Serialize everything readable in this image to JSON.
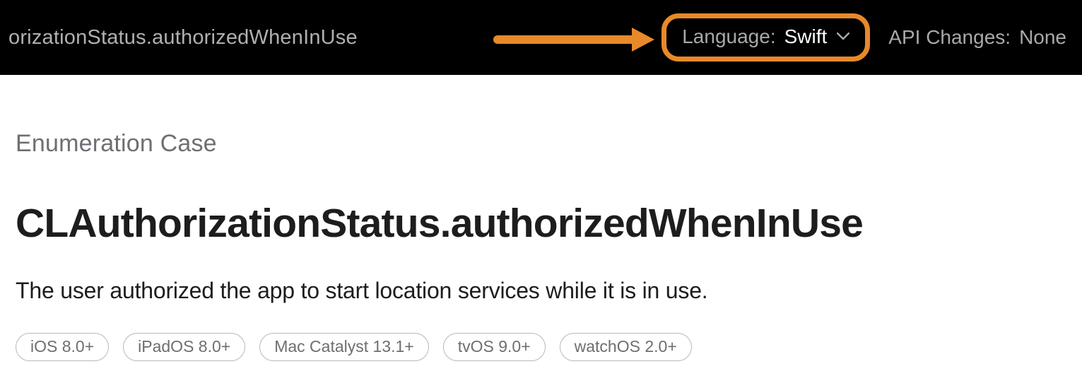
{
  "header": {
    "breadcrumb_fragment": "orizationStatus.authorizedWhenInUse",
    "language_label": "Language:",
    "language_value": "Swift",
    "api_changes_label": "API Changes:",
    "api_changes_value": "None"
  },
  "annotation": {
    "highlight_target": "language-selector",
    "arrow_color": "#e8892a"
  },
  "page": {
    "eyebrow": "Enumeration Case",
    "title": "CLAuthorizationStatus.authorizedWhenInUse",
    "summary": "The user authorized the app to start location services while it is in use.",
    "platforms": [
      "iOS 8.0+",
      "iPadOS 8.0+",
      "Mac Catalyst 13.1+",
      "tvOS 9.0+",
      "watchOS 2.0+"
    ]
  }
}
